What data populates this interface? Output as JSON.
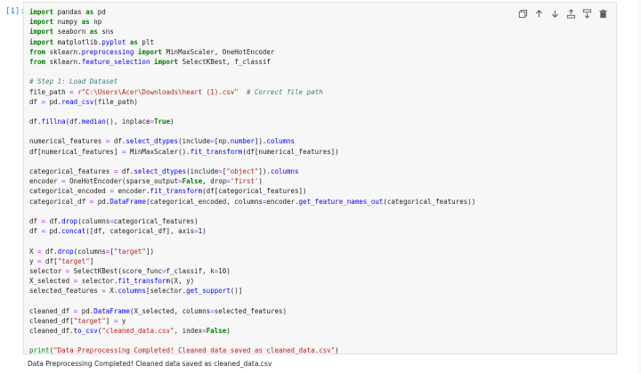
{
  "cell": {
    "prompt": "[1]:",
    "toolbar": [
      "copy-icon",
      "move-up-icon",
      "move-down-icon",
      "insert-above-icon",
      "insert-below-icon",
      "delete-icon"
    ],
    "code_lines": [
      "import pandas as pd",
      "import numpy as np",
      "import seaborn as sns",
      "import matplotlib.pyplot as plt",
      "from sklearn.preprocessing import MinMaxScaler, OneHotEncoder",
      "from sklearn.feature_selection import SelectKBest, f_classif",
      "",
      "# Step 1: Load Dataset",
      "file_path = r\"C:\\Users\\Acer\\Downloads\\heart (1).csv\"  # Correct file path",
      "df = pd.read_csv(file_path)",
      "",
      "df.fillna(df.median(), inplace=True)",
      "",
      "numerical_features = df.select_dtypes(include=[np.number]).columns",
      "df[numerical_features] = MinMaxScaler().fit_transform(df[numerical_features])",
      "",
      "categorical_features = df.select_dtypes(include=[\"object\"]).columns",
      "encoder = OneHotEncoder(sparse_output=False, drop='first')",
      "categorical_encoded = encoder.fit_transform(df[categorical_features])",
      "categorical_df = pd.DataFrame(categorical_encoded, columns=encoder.get_feature_names_out(categorical_features))",
      "",
      "df = df.drop(columns=categorical_features)",
      "df = pd.concat([df, categorical_df], axis=1)",
      "",
      "X = df.drop(columns=[\"target\"])",
      "y = df[\"target\"]",
      "selector = SelectKBest(score_func=f_classif, k=10)",
      "X_selected = selector.fit_transform(X, y)",
      "selected_features = X.columns[selector.get_support()]",
      "",
      "cleaned_df = pd.DataFrame(X_selected, columns=selected_features)",
      "cleaned_df[\"target\"] = y",
      "cleaned_df.to_csv(\"cleaned_data.csv\", index=False)",
      "",
      "print(\"Data Preprocessing Completed! Cleaned data saved as cleaned_data.csv\")"
    ],
    "output": "Data Preprocessing Completed! Cleaned data saved as cleaned_data.csv"
  }
}
